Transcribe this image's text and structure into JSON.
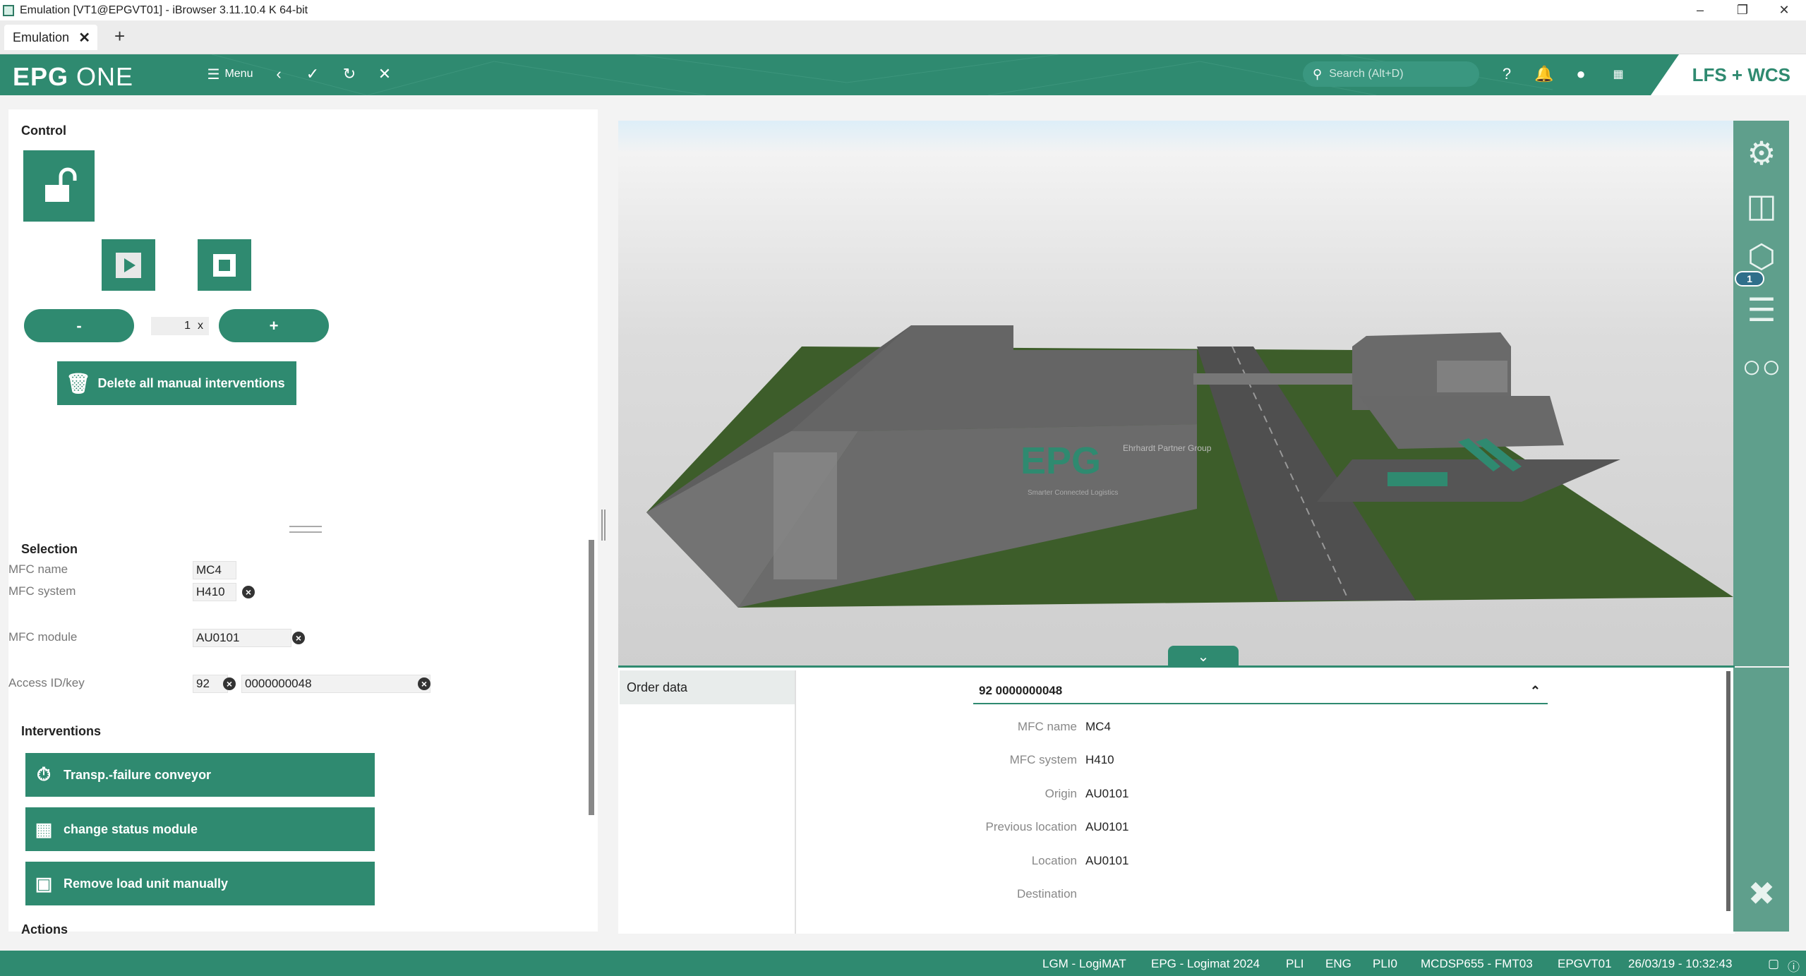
{
  "window": {
    "title": "Emulation [VT1@EPGVT01] - iBrowser 3.11.10.4 K 64-bit",
    "minimize": "–",
    "maximize": "❐",
    "close": "✕"
  },
  "tabs": [
    {
      "label": "Emulation",
      "close": "✕"
    }
  ],
  "new_tab": "+",
  "header": {
    "logo_bold": "EPG",
    "logo_light": "ONE",
    "menu_label": "Menu",
    "search_placeholder": "Search (Alt+D)",
    "product": "LFS + WCS"
  },
  "control": {
    "title": "Control",
    "minus": "-",
    "plus": "+",
    "speed_value": "1",
    "speed_unit": "x",
    "delete_label": "Delete all manual interventions"
  },
  "selection": {
    "title": "Selection",
    "mfc_name_label": "MFC name",
    "mfc_name_value": "MC4",
    "mfc_system_label": "MFC system",
    "mfc_system_value": "H410",
    "mfc_module_label": "MFC module",
    "mfc_module_value": "AU0101",
    "access_label": "Access ID/key",
    "access_id": "92",
    "access_key": "0000000048"
  },
  "interventions": {
    "title": "Interventions",
    "items": [
      {
        "label": "Transp.-failure conveyor",
        "icon": "stopwatch-icon"
      },
      {
        "label": "change status module",
        "icon": "module-status-icon"
      },
      {
        "label": "Remove load unit manually",
        "icon": "remove-load-icon"
      }
    ]
  },
  "actions": {
    "title": "Actions"
  },
  "view3d": {
    "badge": "1",
    "scene_text_logo": "EPG",
    "scene_text_small": "Ehrhardt Partner Group",
    "scene_text_tagline": "Smarter Connected Logistics"
  },
  "order": {
    "tab_label": "Order data",
    "selected_order": "92 0000000048",
    "rows": [
      {
        "label": "MFC name",
        "value": "MC4"
      },
      {
        "label": "MFC system",
        "value": "H410"
      },
      {
        "label": "Origin",
        "value": "AU0101"
      },
      {
        "label": "Previous location",
        "value": "AU0101"
      },
      {
        "label": "Location",
        "value": "AU0101"
      },
      {
        "label": "Destination",
        "value": ""
      }
    ]
  },
  "status": {
    "items": [
      "LGM - LogiMAT",
      "EPG - Logimat 2024",
      "PLI",
      "ENG",
      "PLI0",
      "MCDSP655 - FMT03",
      "EPGVT01",
      "26/03/19 - 10:32:43"
    ]
  },
  "colors": {
    "brand": "#2f8a70",
    "toolbar": "#5f9f8c"
  }
}
